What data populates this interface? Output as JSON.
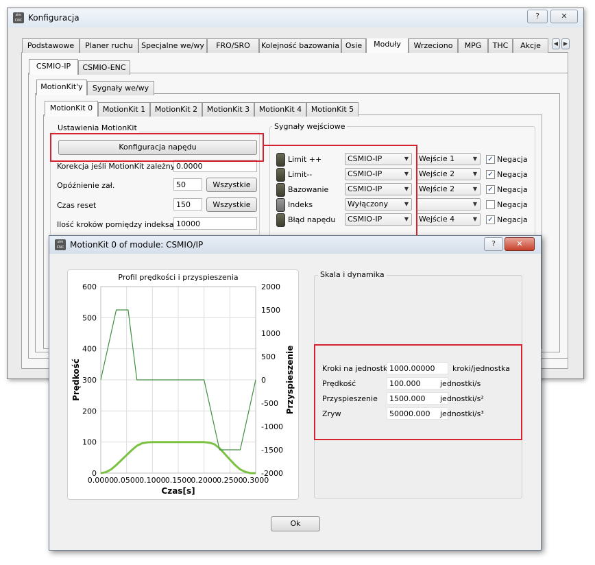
{
  "main_window": {
    "title": "Konfiguracja",
    "icon_text": "sim CNC",
    "help_btn": "?",
    "close_btn": "✕",
    "top_tabs": [
      "Podstawowe",
      "Planer ruchu",
      "Specjalne we/wy",
      "FRO/SRO",
      "Kolejność bazowania",
      "Osie",
      "Moduły",
      "Wrzeciono",
      "MPG",
      "THC",
      "Akcje"
    ],
    "active_top_tab": "Moduły",
    "tab_scroll_left": "◀",
    "tab_scroll_right": "▶",
    "module_tabs": [
      "CSMIO-IP",
      "CSMIO-ENC"
    ],
    "sub_tabs": [
      "MotionKit'y",
      "Sygnały we/wy"
    ],
    "motionkit_tabs": [
      "MotionKit 0",
      "MotionKit 1",
      "MotionKit 2",
      "MotionKit 3",
      "MotionKit 4",
      "MotionKit 5"
    ],
    "settings_group": {
      "title": "Ustawienia MotionKit",
      "config_btn": "Konfiguracja napędu",
      "rows": [
        {
          "label": "Korekcja jeśli MotionKit zależny",
          "value": "0.0000"
        },
        {
          "label": "Opóźnienie zał.",
          "value": "50",
          "button": "Wszystkie"
        },
        {
          "label": "Czas reset",
          "value": "150",
          "button": "Wszystkie"
        },
        {
          "label": "Ilość kroków pomiędzy indeksami",
          "value": "10000"
        }
      ]
    },
    "signals_group": {
      "title": "Sygnały wejściowe",
      "rows": [
        {
          "name": "Limit ++",
          "module": "CSMIO-IP",
          "input": "Wejście 1",
          "negation": "Negacja",
          "checked": true
        },
        {
          "name": "Limit--",
          "module": "CSMIO-IP",
          "input": "Wejście 2",
          "negation": "Negacja",
          "checked": true
        },
        {
          "name": "Bazowanie",
          "module": "CSMIO-IP",
          "input": "Wejście 2",
          "negation": "Negacja",
          "checked": true
        },
        {
          "name": "Indeks",
          "module": "Wyłączony",
          "input": "",
          "negation": "Negacja",
          "checked": false
        },
        {
          "name": "Błąd napędu",
          "module": "CSMIO-IP",
          "input": "Wejście 4",
          "negation": "Negacja",
          "checked": true
        }
      ]
    }
  },
  "dialog": {
    "title": "MotionKit 0 of module: CSMIO/IP",
    "icon_text": "sim CNC",
    "help_btn": "?",
    "close_btn": "✕",
    "scale_group_title": "Skala i dynamika",
    "params": [
      {
        "label": "Kroki na jednostkę",
        "value": "1000.00000",
        "unit": "kroki/jednostka"
      },
      {
        "label": "Prędkość",
        "value": "100.000",
        "unit": "jednostki/s"
      },
      {
        "label": "Przyspieszenie",
        "value": "1500.000",
        "unit": "jednostki/s²"
      },
      {
        "label": "Zryw",
        "value": "50000.000",
        "unit": "jednostki/s³"
      }
    ],
    "ok_btn": "Ok"
  },
  "chart_data": {
    "type": "line",
    "title": "Profil prędkości i przyspieszenia",
    "xlabel": "Czas[s]",
    "ylabel": "Prędkość",
    "y2label": "Przyspieszenie",
    "xlim": [
      0,
      0.3
    ],
    "ylim": [
      0,
      600
    ],
    "y2lim": [
      -2000,
      2000
    ],
    "x_ticks": [
      "0.0000",
      "0.0500",
      "0.1000",
      "0.1500",
      "0.2000",
      "0.2500",
      "0.3000"
    ],
    "y_ticks": [
      "0",
      "100",
      "200",
      "300",
      "400",
      "500",
      "600"
    ],
    "y2_ticks": [
      "-2000",
      "-1500",
      "-1000",
      "-500",
      "0",
      "500",
      "1000",
      "1500",
      "2000"
    ],
    "grid": true,
    "colors": {
      "velocity": "#7cc242",
      "acceleration": "#3f8f3f"
    },
    "series": [
      {
        "axis": "left",
        "x": [
          0,
          0.01,
          0.02,
          0.03,
          0.04,
          0.05,
          0.06,
          0.07,
          0.08,
          0.09,
          0.1,
          0.14,
          0.18,
          0.2,
          0.21,
          0.22,
          0.23,
          0.24,
          0.25,
          0.26,
          0.27,
          0.28,
          0.29,
          0.3
        ],
        "y": [
          0,
          3,
          12,
          26,
          42,
          58,
          74,
          88,
          96,
          99,
          100,
          100,
          100,
          100,
          98,
          93,
          80,
          62,
          44,
          26,
          12,
          4,
          0,
          0
        ]
      },
      {
        "axis": "right",
        "x": [
          0,
          0.03,
          0.053,
          0.07,
          0.1,
          0.2,
          0.23,
          0.27,
          0.3
        ],
        "y": [
          0,
          1500,
          1500,
          0,
          0,
          0,
          -1500,
          -1500,
          0
        ]
      }
    ]
  }
}
